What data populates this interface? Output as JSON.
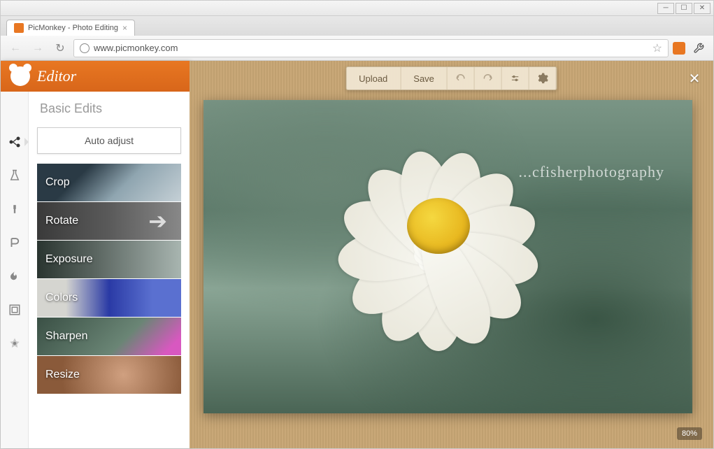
{
  "browser": {
    "tab_title": "PicMonkey - Photo Editing",
    "url": "www.picmonkey.com"
  },
  "header": {
    "title": "Editor"
  },
  "panel": {
    "title": "Basic Edits",
    "auto_adjust": "Auto adjust",
    "items": [
      {
        "label": "Crop"
      },
      {
        "label": "Rotate"
      },
      {
        "label": "Exposure"
      },
      {
        "label": "Colors"
      },
      {
        "label": "Sharpen"
      },
      {
        "label": "Resize"
      }
    ]
  },
  "toolbar": {
    "upload": "Upload",
    "save": "Save"
  },
  "canvas": {
    "watermark": "...cfisherphotography",
    "zoom": "80%"
  }
}
